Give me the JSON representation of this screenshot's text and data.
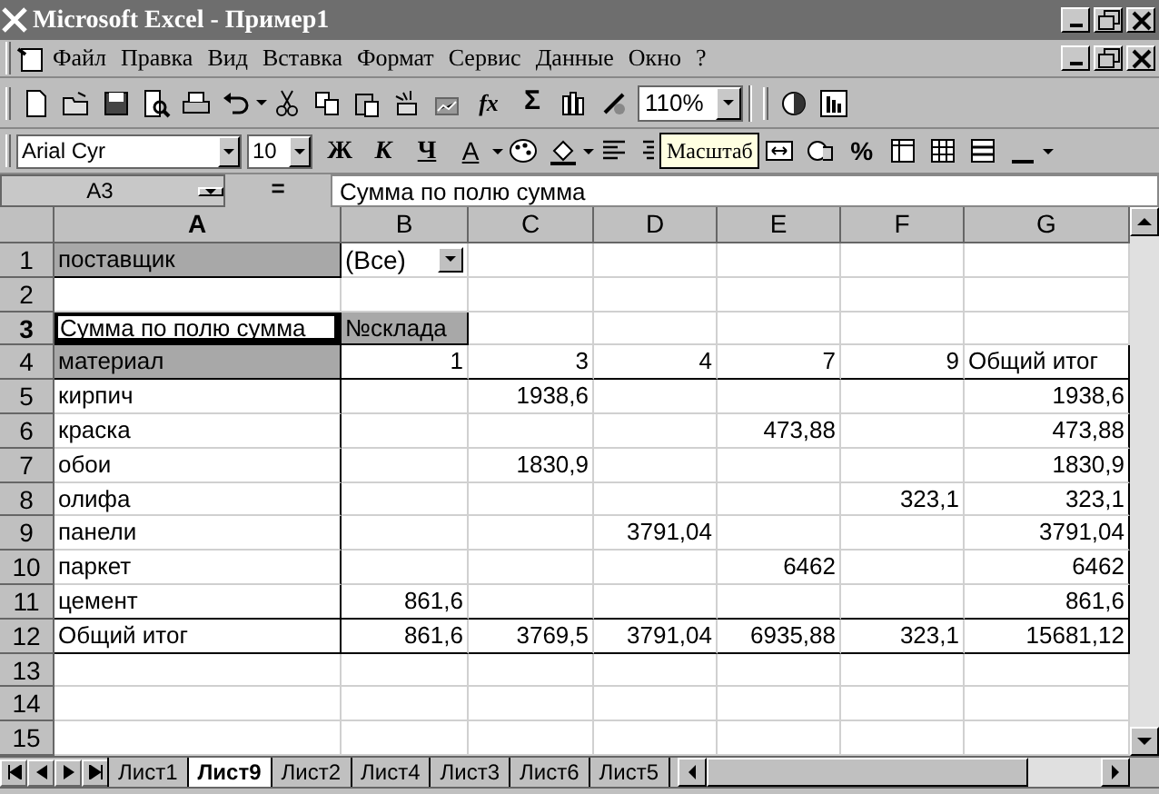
{
  "window": {
    "title": "Microsoft Excel - Пример1"
  },
  "menu": [
    "Файл",
    "Правка",
    "Вид",
    "Вставка",
    "Формат",
    "Сервис",
    "Данные",
    "Окно",
    "?"
  ],
  "standard_toolbar": {
    "function_button": "fx",
    "sum_button": "Σ",
    "zoom": "110%"
  },
  "formatting_toolbar": {
    "font": "Arial Cyr",
    "size": "10",
    "bold": "Ж",
    "italic": "К",
    "underline": "Ч",
    "font_color": "A",
    "percent": "%"
  },
  "tooltip": "Масштаб",
  "formula_bar": {
    "name_box": "A3",
    "equals": "=",
    "content": "Сумма по полю сумма"
  },
  "columns": [
    {
      "label": "A",
      "selected": true
    },
    {
      "label": "B",
      "selected": false
    },
    {
      "label": "C",
      "selected": false
    },
    {
      "label": "D",
      "selected": false
    },
    {
      "label": "E",
      "selected": false
    },
    {
      "label": "F",
      "selected": false
    },
    {
      "label": "G",
      "selected": false
    }
  ],
  "rows": [
    {
      "label": "1",
      "selected": false,
      "cells": [
        {
          "text": "поставщик",
          "kind": "field"
        },
        {
          "text": "(Все)",
          "kind": "dropdown"
        },
        null,
        null,
        null,
        null,
        null
      ]
    },
    {
      "label": "2",
      "selected": false,
      "cells": [
        null,
        null,
        null,
        null,
        null,
        null,
        null
      ]
    },
    {
      "label": "3",
      "selected": true,
      "cells": [
        {
          "text": "Сумма по полю сумма",
          "kind": "selected"
        },
        {
          "text": "№склада",
          "kind": "field"
        },
        null,
        null,
        null,
        null,
        null
      ]
    },
    {
      "label": "4",
      "selected": false,
      "cells": [
        {
          "text": "материал",
          "kind": "field"
        },
        {
          "text": "1",
          "kind": "number"
        },
        {
          "text": "3",
          "kind": "number"
        },
        {
          "text": "4",
          "kind": "number"
        },
        {
          "text": "7",
          "kind": "number"
        },
        {
          "text": "9",
          "kind": "number"
        },
        {
          "text": "Общий итог",
          "kind": "text"
        }
      ]
    },
    {
      "label": "5",
      "selected": false,
      "cells": [
        {
          "text": "кирпич",
          "kind": "text"
        },
        null,
        {
          "text": "1938,6",
          "kind": "number"
        },
        null,
        null,
        null,
        {
          "text": "1938,6",
          "kind": "number"
        }
      ]
    },
    {
      "label": "6",
      "selected": false,
      "cells": [
        {
          "text": "краска",
          "kind": "text"
        },
        null,
        null,
        null,
        {
          "text": "473,88",
          "kind": "number"
        },
        null,
        {
          "text": "473,88",
          "kind": "number"
        }
      ]
    },
    {
      "label": "7",
      "selected": false,
      "cells": [
        {
          "text": "обои",
          "kind": "text"
        },
        null,
        {
          "text": "1830,9",
          "kind": "number"
        },
        null,
        null,
        null,
        {
          "text": "1830,9",
          "kind": "number"
        }
      ]
    },
    {
      "label": "8",
      "selected": false,
      "cells": [
        {
          "text": "олифа",
          "kind": "text"
        },
        null,
        null,
        null,
        null,
        {
          "text": "323,1",
          "kind": "number"
        },
        {
          "text": "323,1",
          "kind": "number"
        }
      ]
    },
    {
      "label": "9",
      "selected": false,
      "cells": [
        {
          "text": "панели",
          "kind": "text"
        },
        null,
        null,
        {
          "text": "3791,04",
          "kind": "number"
        },
        null,
        null,
        {
          "text": "3791,04",
          "kind": "number"
        }
      ]
    },
    {
      "label": "10",
      "selected": false,
      "cells": [
        {
          "text": "паркет",
          "kind": "text"
        },
        null,
        null,
        null,
        {
          "text": "6462",
          "kind": "number"
        },
        null,
        {
          "text": "6462",
          "kind": "number"
        }
      ]
    },
    {
      "label": "11",
      "selected": false,
      "cells": [
        {
          "text": "цемент",
          "kind": "text"
        },
        {
          "text": "861,6",
          "kind": "number"
        },
        null,
        null,
        null,
        null,
        {
          "text": "861,6",
          "kind": "number"
        }
      ]
    },
    {
      "label": "12",
      "selected": false,
      "cells": [
        {
          "text": "Общий итог",
          "kind": "text"
        },
        {
          "text": "861,6",
          "kind": "number"
        },
        {
          "text": "3769,5",
          "kind": "number"
        },
        {
          "text": "3791,04",
          "kind": "number"
        },
        {
          "text": "6935,88",
          "kind": "number"
        },
        {
          "text": "323,1",
          "kind": "number"
        },
        {
          "text": "15681,12",
          "kind": "number"
        }
      ]
    },
    {
      "label": "13",
      "selected": false,
      "cells": [
        null,
        null,
        null,
        null,
        null,
        null,
        null
      ]
    },
    {
      "label": "14",
      "selected": false,
      "cells": [
        null,
        null,
        null,
        null,
        null,
        null,
        null
      ]
    },
    {
      "label": "15",
      "selected": false,
      "cells": [
        null,
        null,
        null,
        null,
        null,
        null,
        null
      ]
    }
  ],
  "sheet_tabs": [
    {
      "label": "Лист1",
      "selected": false
    },
    {
      "label": "Лист9",
      "selected": true
    },
    {
      "label": "Лист2",
      "selected": false
    },
    {
      "label": "Лист4",
      "selected": false
    },
    {
      "label": "Лист3",
      "selected": false
    },
    {
      "label": "Лист6",
      "selected": false
    },
    {
      "label": "Лист5",
      "selected": false
    }
  ]
}
